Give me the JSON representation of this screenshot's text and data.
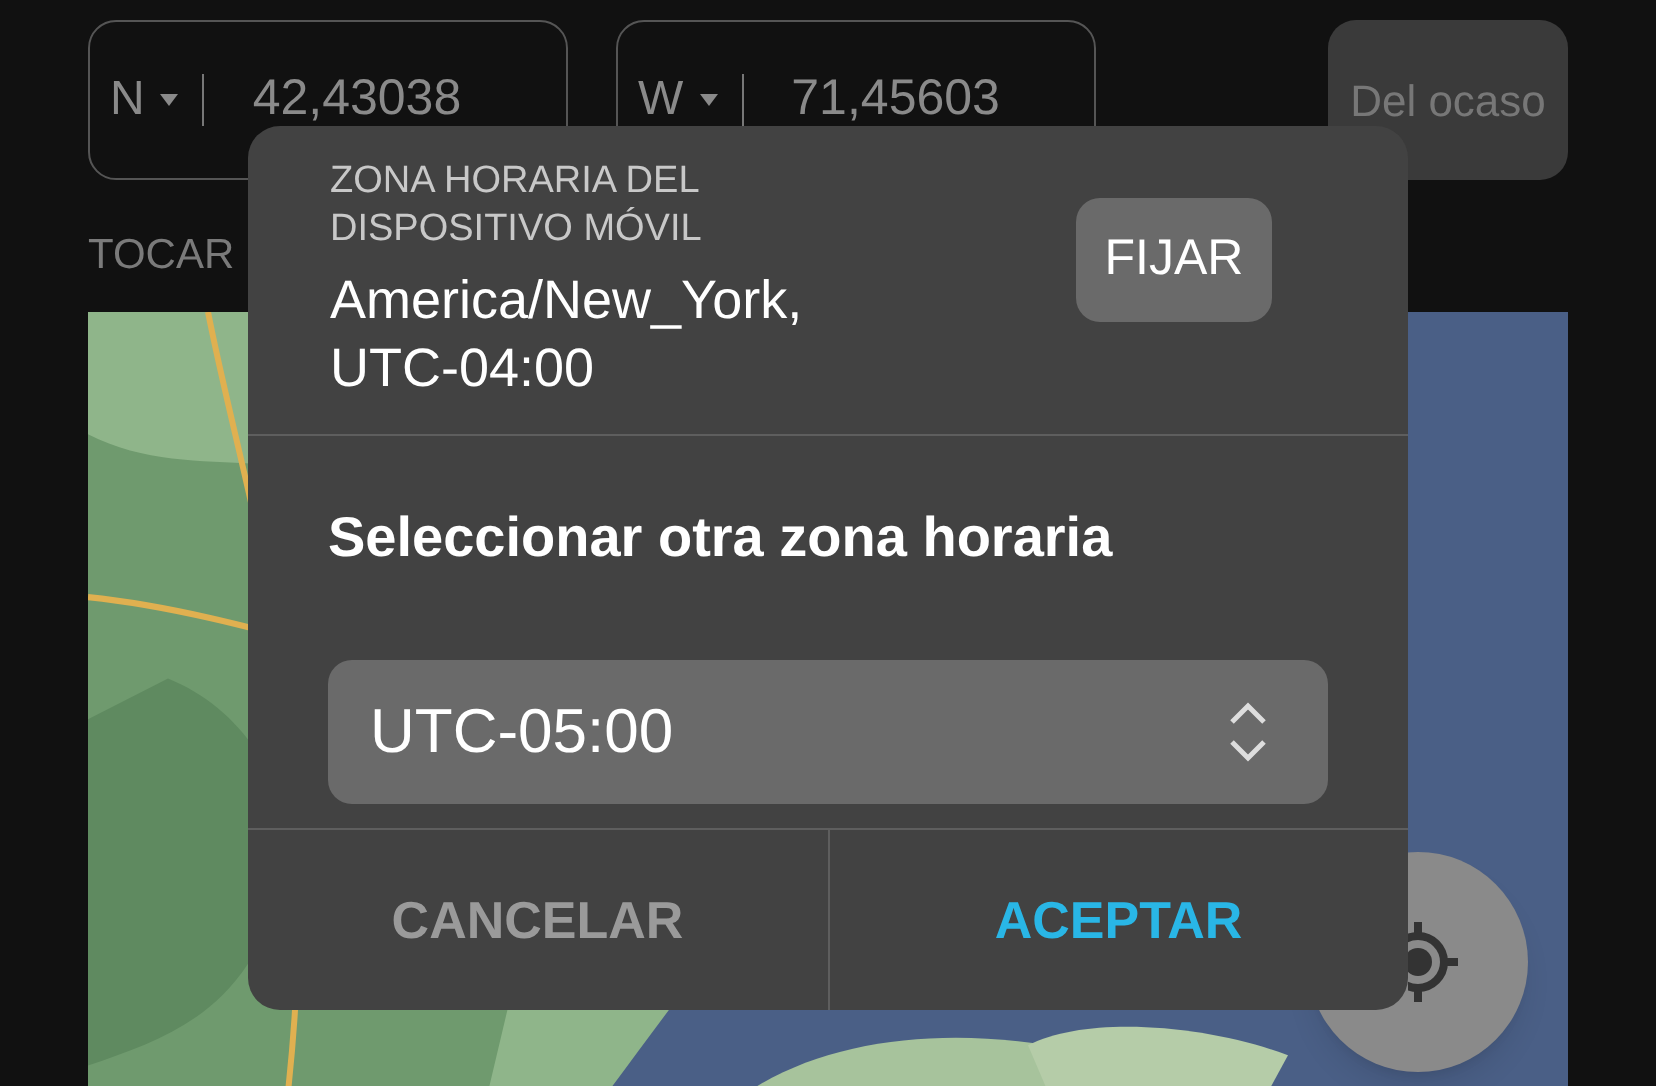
{
  "coordinates": [
    {
      "hemisphere": "N",
      "value": "42,43038"
    },
    {
      "hemisphere": "W",
      "value": "71,45603"
    }
  ],
  "sunset_button": "Del ocaso",
  "map_hint": "TOCAR",
  "dialog": {
    "device_label": "ZONA HORARIA DEL DISPOSITIVO MÓVIL",
    "device_zone": "America/New_York, UTC-04:00",
    "set_button": "FIJAR",
    "select_label": "Seleccionar otra zona horaria",
    "selected_zone": "UTC-05:00",
    "actions": [
      {
        "label": "CANCELAR",
        "kind": "secondary"
      },
      {
        "label": "ACEPTAR",
        "kind": "primary"
      }
    ]
  }
}
